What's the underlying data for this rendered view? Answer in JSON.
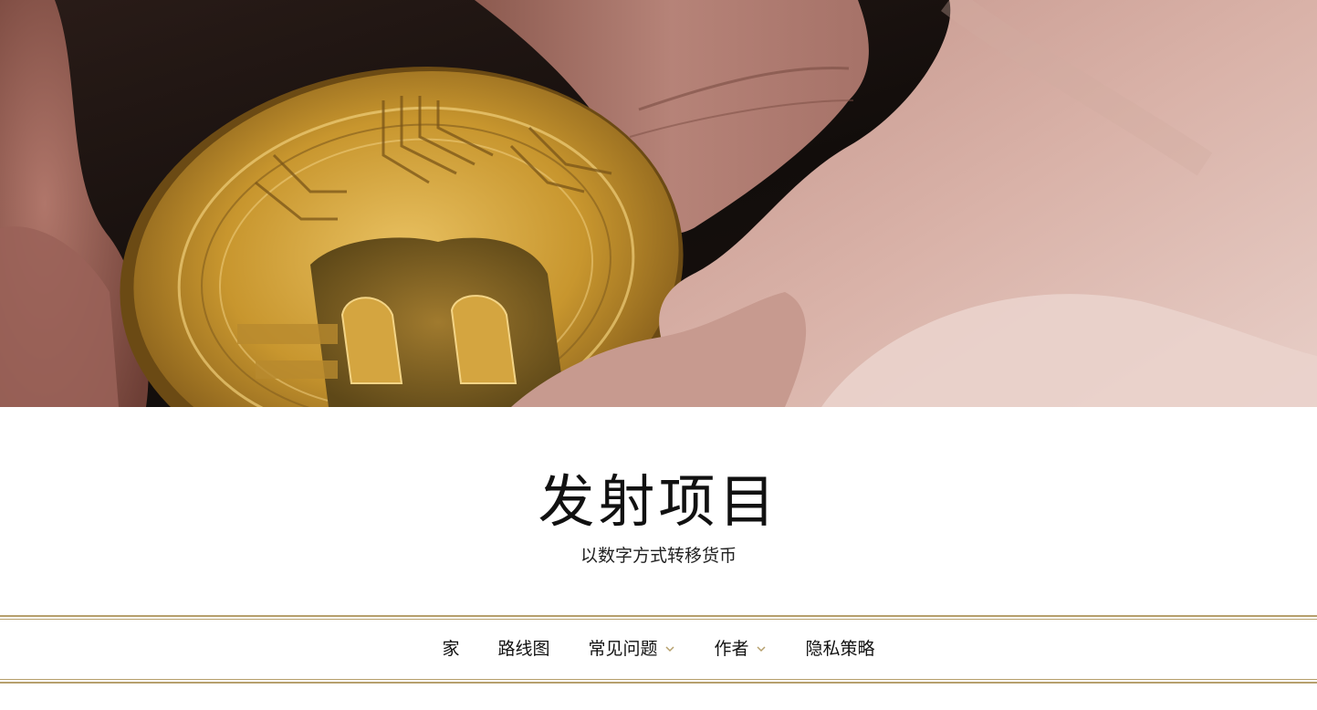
{
  "hero": {
    "image_icon": "bitcoin-coin-in-hand-photo"
  },
  "site": {
    "title": "发射项目",
    "tagline": "以数字方式转移货币"
  },
  "nav": {
    "items": [
      {
        "label": "家",
        "has_submenu": false
      },
      {
        "label": "路线图",
        "has_submenu": false
      },
      {
        "label": "常见问题",
        "has_submenu": true
      },
      {
        "label": "作者",
        "has_submenu": true
      },
      {
        "label": "隐私策略",
        "has_submenu": false
      }
    ],
    "chevron_icon": "chevron-down-icon"
  },
  "colors": {
    "accent_gold": "#b6a06d",
    "text": "#111111",
    "background": "#ffffff"
  }
}
